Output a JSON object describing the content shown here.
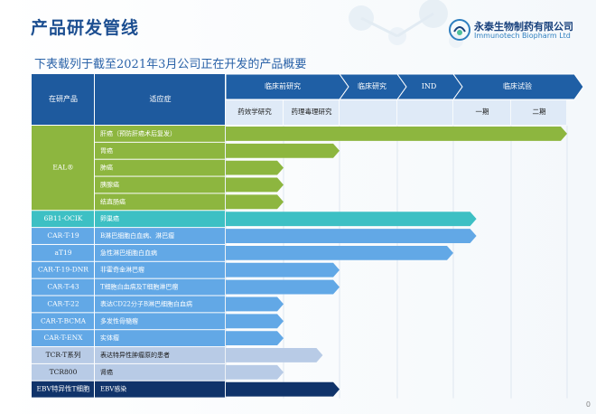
{
  "header": {
    "title": "产品研发管线",
    "subtitle": "下表载列于截至2021年3月公司正在开发的产品概要",
    "page_number": "0"
  },
  "logo": {
    "name_zh": "永泰生物制药有限公司",
    "name_en": "Immunotech Biopharm Ltd"
  },
  "colors": {
    "header_blue": "#1e5a9e",
    "stage_header": "#1f5fa5",
    "green": "#8db63f",
    "cyan": "#3dc0c4",
    "light_blue": "#62a8e6",
    "lavender": "#b8cbe6",
    "navy": "#10336a"
  },
  "chart_data": {
    "type": "table",
    "columns": {
      "product": "在研产品",
      "indication": "适应症"
    },
    "stages": [
      {
        "label": "临床前研究",
        "sub": [
          "药效学研究",
          "药理毒理研究"
        ]
      },
      {
        "label": "临床研究",
        "sub": [
          ""
        ]
      },
      {
        "label": "IND",
        "sub": [
          ""
        ]
      },
      {
        "label": "临床试验",
        "sub": [
          "一期",
          "二期"
        ]
      }
    ],
    "rows": [
      {
        "product": "EAL®",
        "indication": "肝癌（预防肝癌术后复发）",
        "progress": 6.0,
        "color": "green"
      },
      {
        "product": "EAL®",
        "indication": "胃癌",
        "progress": 2.0,
        "color": "green"
      },
      {
        "product": "EAL®",
        "indication": "肺癌",
        "progress": 1.0,
        "color": "green"
      },
      {
        "product": "EAL®",
        "indication": "胰腺癌",
        "progress": 1.0,
        "color": "green"
      },
      {
        "product": "EAL®",
        "indication": "结直肠癌",
        "progress": 1.0,
        "color": "green"
      },
      {
        "product": "6B11-OCIK",
        "indication": "卵巢癌",
        "progress": 4.4,
        "color": "cyan"
      },
      {
        "product": "CAR-T-19",
        "indication": "B淋巴细胞白血病、淋巴瘤",
        "progress": 4.4,
        "color": "light_blue"
      },
      {
        "product": "aT19",
        "indication": "急性淋巴细胞白血病",
        "progress": 4.0,
        "color": "light_blue"
      },
      {
        "product": "CAR-T-19-DNR",
        "indication": "非霍奇金淋巴瘤",
        "progress": 2.0,
        "color": "light_blue"
      },
      {
        "product": "CAR-T-43",
        "indication": "T细胞白血病及T细胞淋巴瘤",
        "progress": 2.0,
        "color": "light_blue"
      },
      {
        "product": "CAR-T-22",
        "indication": "表达CD22分子B淋巴细胞白血病",
        "progress": 1.0,
        "color": "light_blue"
      },
      {
        "product": "CAR-T-BCMA",
        "indication": "多发性骨髓瘤",
        "progress": 1.0,
        "color": "light_blue"
      },
      {
        "product": "CAR-T-ENX",
        "indication": "实体瘤",
        "progress": 1.0,
        "color": "light_blue"
      },
      {
        "product": "TCR-T系列",
        "indication": "表达特异性肿瘤原的患者",
        "progress": 1.7,
        "color": "lavender"
      },
      {
        "product": "TCR800",
        "indication": "肾癌",
        "progress": 1.0,
        "color": "lavender"
      },
      {
        "product": "EBV特异性T细胞",
        "indication": "EBV感染",
        "progress": 2.0,
        "color": "navy"
      }
    ]
  }
}
